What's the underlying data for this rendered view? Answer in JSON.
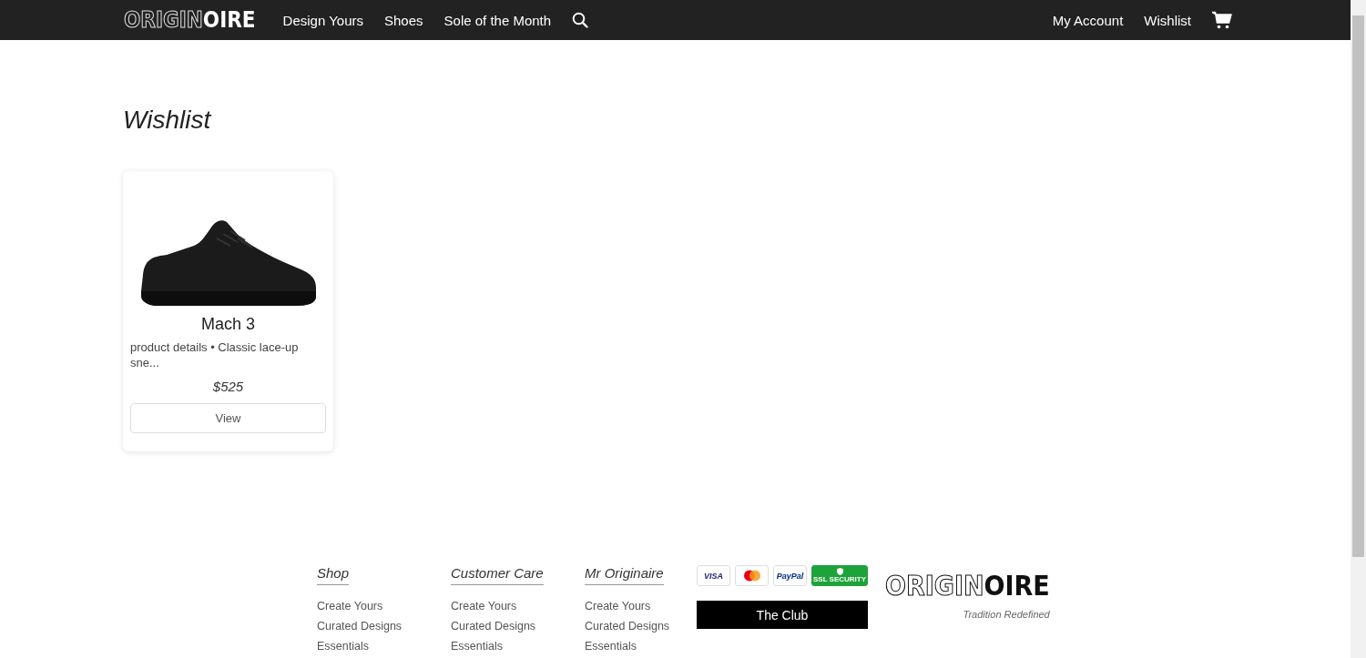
{
  "navbar": {
    "logo": {
      "outlined": "ORIGIN",
      "solid": "OIRE"
    },
    "links": [
      {
        "label": "Design Yours"
      },
      {
        "label": "Shoes"
      },
      {
        "label": "Sole of the Month"
      }
    ],
    "right_links": [
      {
        "label": "My Account"
      },
      {
        "label": "Wishlist"
      }
    ]
  },
  "page_title": "Wishlist",
  "wishlist": [
    {
      "name": "Mach 3",
      "description": "product details • Classic lace-up sne...",
      "price": "$525",
      "button": "View"
    }
  ],
  "footer": {
    "columns": [
      {
        "title": "Shop",
        "links": [
          "Create Yours",
          "Curated Designs",
          "Essentials"
        ]
      },
      {
        "title": "Customer Care",
        "links": [
          "Create Yours",
          "Curated Designs",
          "Essentials"
        ]
      },
      {
        "title": "Mr Originaire",
        "links": [
          "Create Yours",
          "Curated Designs",
          "Essentials"
        ]
      }
    ],
    "payment_badges": [
      {
        "kind": "visa",
        "label": "VISA"
      },
      {
        "kind": "mastercard"
      },
      {
        "kind": "paypal",
        "label": "PayPal"
      },
      {
        "kind": "ssl",
        "label": "SSL SECURITY"
      }
    ],
    "club_button": "The Club",
    "logo": {
      "outlined": "ORIGIN",
      "solid": "OIRE"
    },
    "tagline": "Tradition Redefined"
  }
}
